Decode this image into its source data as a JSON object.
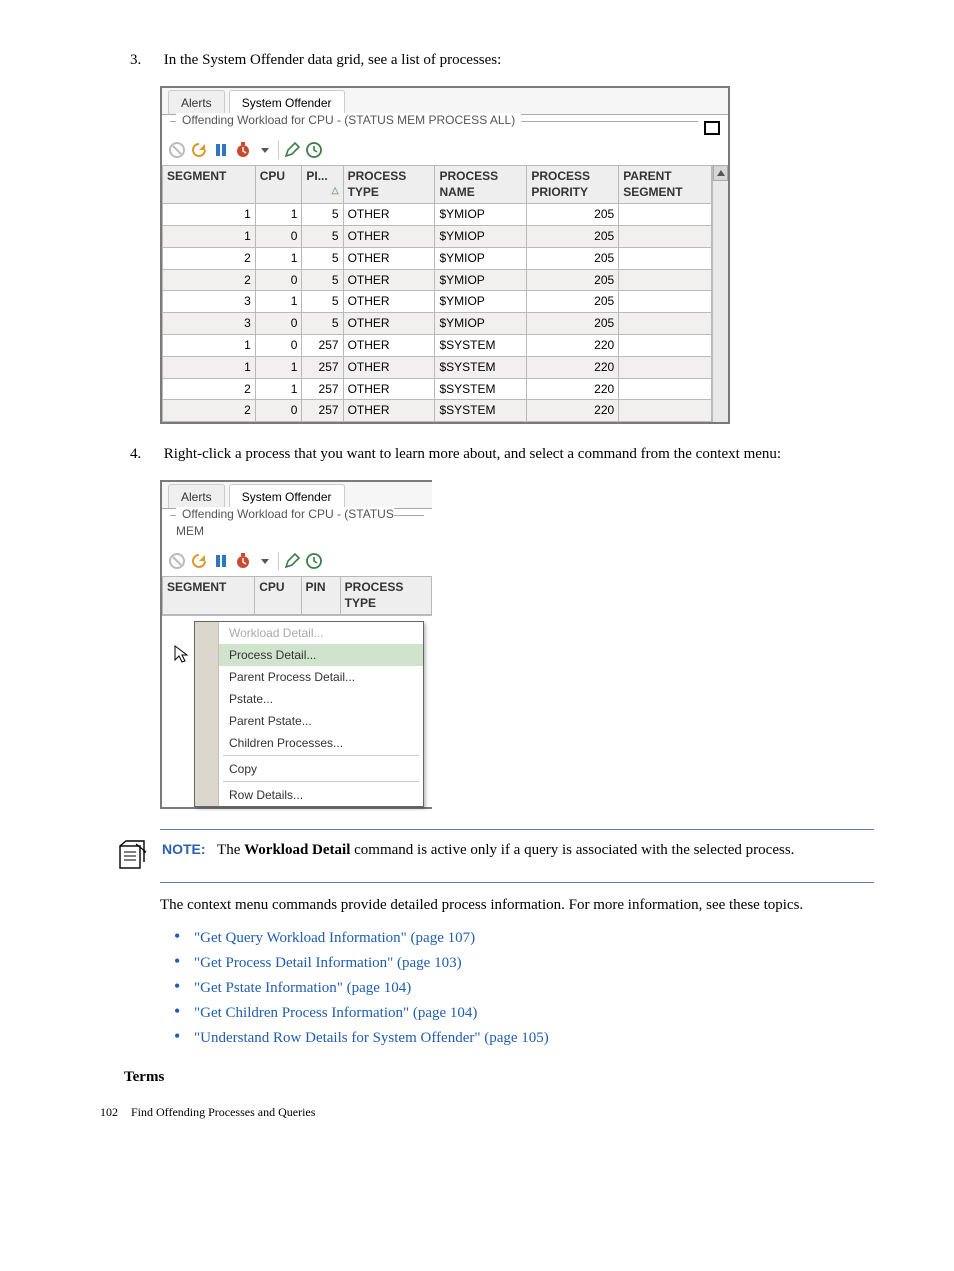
{
  "step3": {
    "num": "3.",
    "text": "In the System Offender data grid, see a list of processes:"
  },
  "panel1": {
    "tabs": [
      "Alerts",
      "System Offender"
    ],
    "activeTab": 1,
    "group": "Offending Workload for CPU - (STATUS MEM PROCESS ALL)",
    "headers": [
      "SEGMENT",
      "CPU",
      "PI...",
      "PROCESS TYPE",
      "PROCESS NAME",
      "PROCESS PRIORITY",
      "PARENT SEGMENT"
    ],
    "rows": [
      [
        "1",
        "1",
        "5",
        "OTHER",
        "$YMIOP",
        "205",
        ""
      ],
      [
        "1",
        "0",
        "5",
        "OTHER",
        "$YMIOP",
        "205",
        ""
      ],
      [
        "2",
        "1",
        "5",
        "OTHER",
        "$YMIOP",
        "205",
        ""
      ],
      [
        "2",
        "0",
        "5",
        "OTHER",
        "$YMIOP",
        "205",
        ""
      ],
      [
        "3",
        "1",
        "5",
        "OTHER",
        "$YMIOP",
        "205",
        ""
      ],
      [
        "3",
        "0",
        "5",
        "OTHER",
        "$YMIOP",
        "205",
        ""
      ],
      [
        "1",
        "0",
        "257",
        "OTHER",
        "$SYSTEM",
        "220",
        ""
      ],
      [
        "1",
        "1",
        "257",
        "OTHER",
        "$SYSTEM",
        "220",
        ""
      ],
      [
        "2",
        "1",
        "257",
        "OTHER",
        "$SYSTEM",
        "220",
        ""
      ],
      [
        "2",
        "0",
        "257",
        "OTHER",
        "$SYSTEM",
        "220",
        ""
      ]
    ]
  },
  "step4": {
    "num": "4.",
    "text": "Right-click a process that you want to learn more about, and select a command from the context menu:"
  },
  "panel2": {
    "tabs": [
      "Alerts",
      "System Offender"
    ],
    "group": "Offending Workload for CPU - (STATUS MEM",
    "headers": [
      "SEGMENT",
      "CPU",
      "PIN",
      "PROCESS TYPE"
    ],
    "menu": [
      {
        "label": "Workload Detail...",
        "disabled": true
      },
      {
        "label": "Process Detail...",
        "hover": true
      },
      {
        "label": "Parent Process Detail..."
      },
      {
        "label": "Pstate..."
      },
      {
        "label": "Parent Pstate..."
      },
      {
        "label": "Children Processes..."
      },
      {
        "sep": true
      },
      {
        "label": "Copy"
      },
      {
        "sep": true
      },
      {
        "label": "Row Details..."
      }
    ]
  },
  "note": {
    "label": "NOTE:",
    "body_before": "The ",
    "bold": "Workload Detail",
    "body_after": " command is active only if a query is associated with the selected process."
  },
  "para": "The context menu commands provide detailed process information. For more information, see these topics.",
  "links": [
    "\"Get Query Workload Information\" (page 107)",
    "\"Get Process Detail Information\" (page 103)",
    "\"Get Pstate Information\" (page 104)",
    "\"Get Children Process Information\" (page 104)",
    "\"Understand Row Details for System Offender\" (page 105)"
  ],
  "terms": "Terms",
  "footer": {
    "page": "102",
    "title": "Find Offending Processes and Queries"
  }
}
